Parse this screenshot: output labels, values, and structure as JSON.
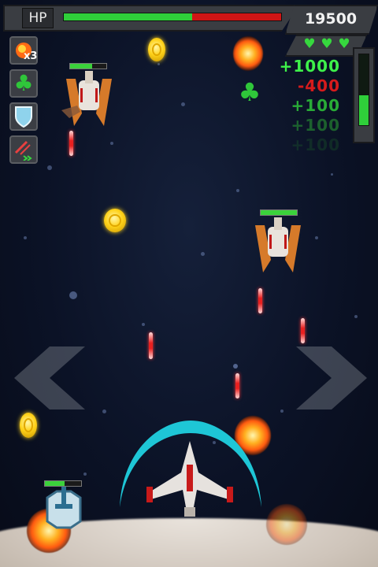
{
  "hud": {
    "hp_label": "HP",
    "hp_fraction": 0.59,
    "score": "19500",
    "lives": 3,
    "power_fraction": 0.42,
    "bomb_count": "x3"
  },
  "popups": [
    {
      "text": "+1000",
      "color": "#3ef04a",
      "opacity": 1.0
    },
    {
      "text": "-400",
      "color": "#e11c1c",
      "opacity": 0.95
    },
    {
      "text": "+100",
      "color": "#2fc63a",
      "opacity": 0.85
    },
    {
      "text": "+100",
      "color": "#2aa134",
      "opacity": 0.55
    },
    {
      "text": "+100",
      "color": "#1f6e2a",
      "opacity": 0.28
    }
  ],
  "powerups": [
    {
      "name": "bomb-powerup-button",
      "icon": "bomb-icon"
    },
    {
      "name": "clover-powerup-button",
      "icon": "clover-icon"
    },
    {
      "name": "shield-powerup-button",
      "icon": "shield-icon"
    },
    {
      "name": "laser-powerup-button",
      "icon": "laser-icon"
    }
  ],
  "enemies": [
    {
      "name": "enemy-ship-1",
      "health_fraction": 0.6
    },
    {
      "name": "enemy-ship-2",
      "health_fraction": 1.0
    }
  ],
  "turret": {
    "health_fraction": 0.55
  },
  "colors": {
    "hp_green": "#2fcf3a",
    "hp_red": "#d01515",
    "shield_cyan": "#1ec6d6"
  }
}
